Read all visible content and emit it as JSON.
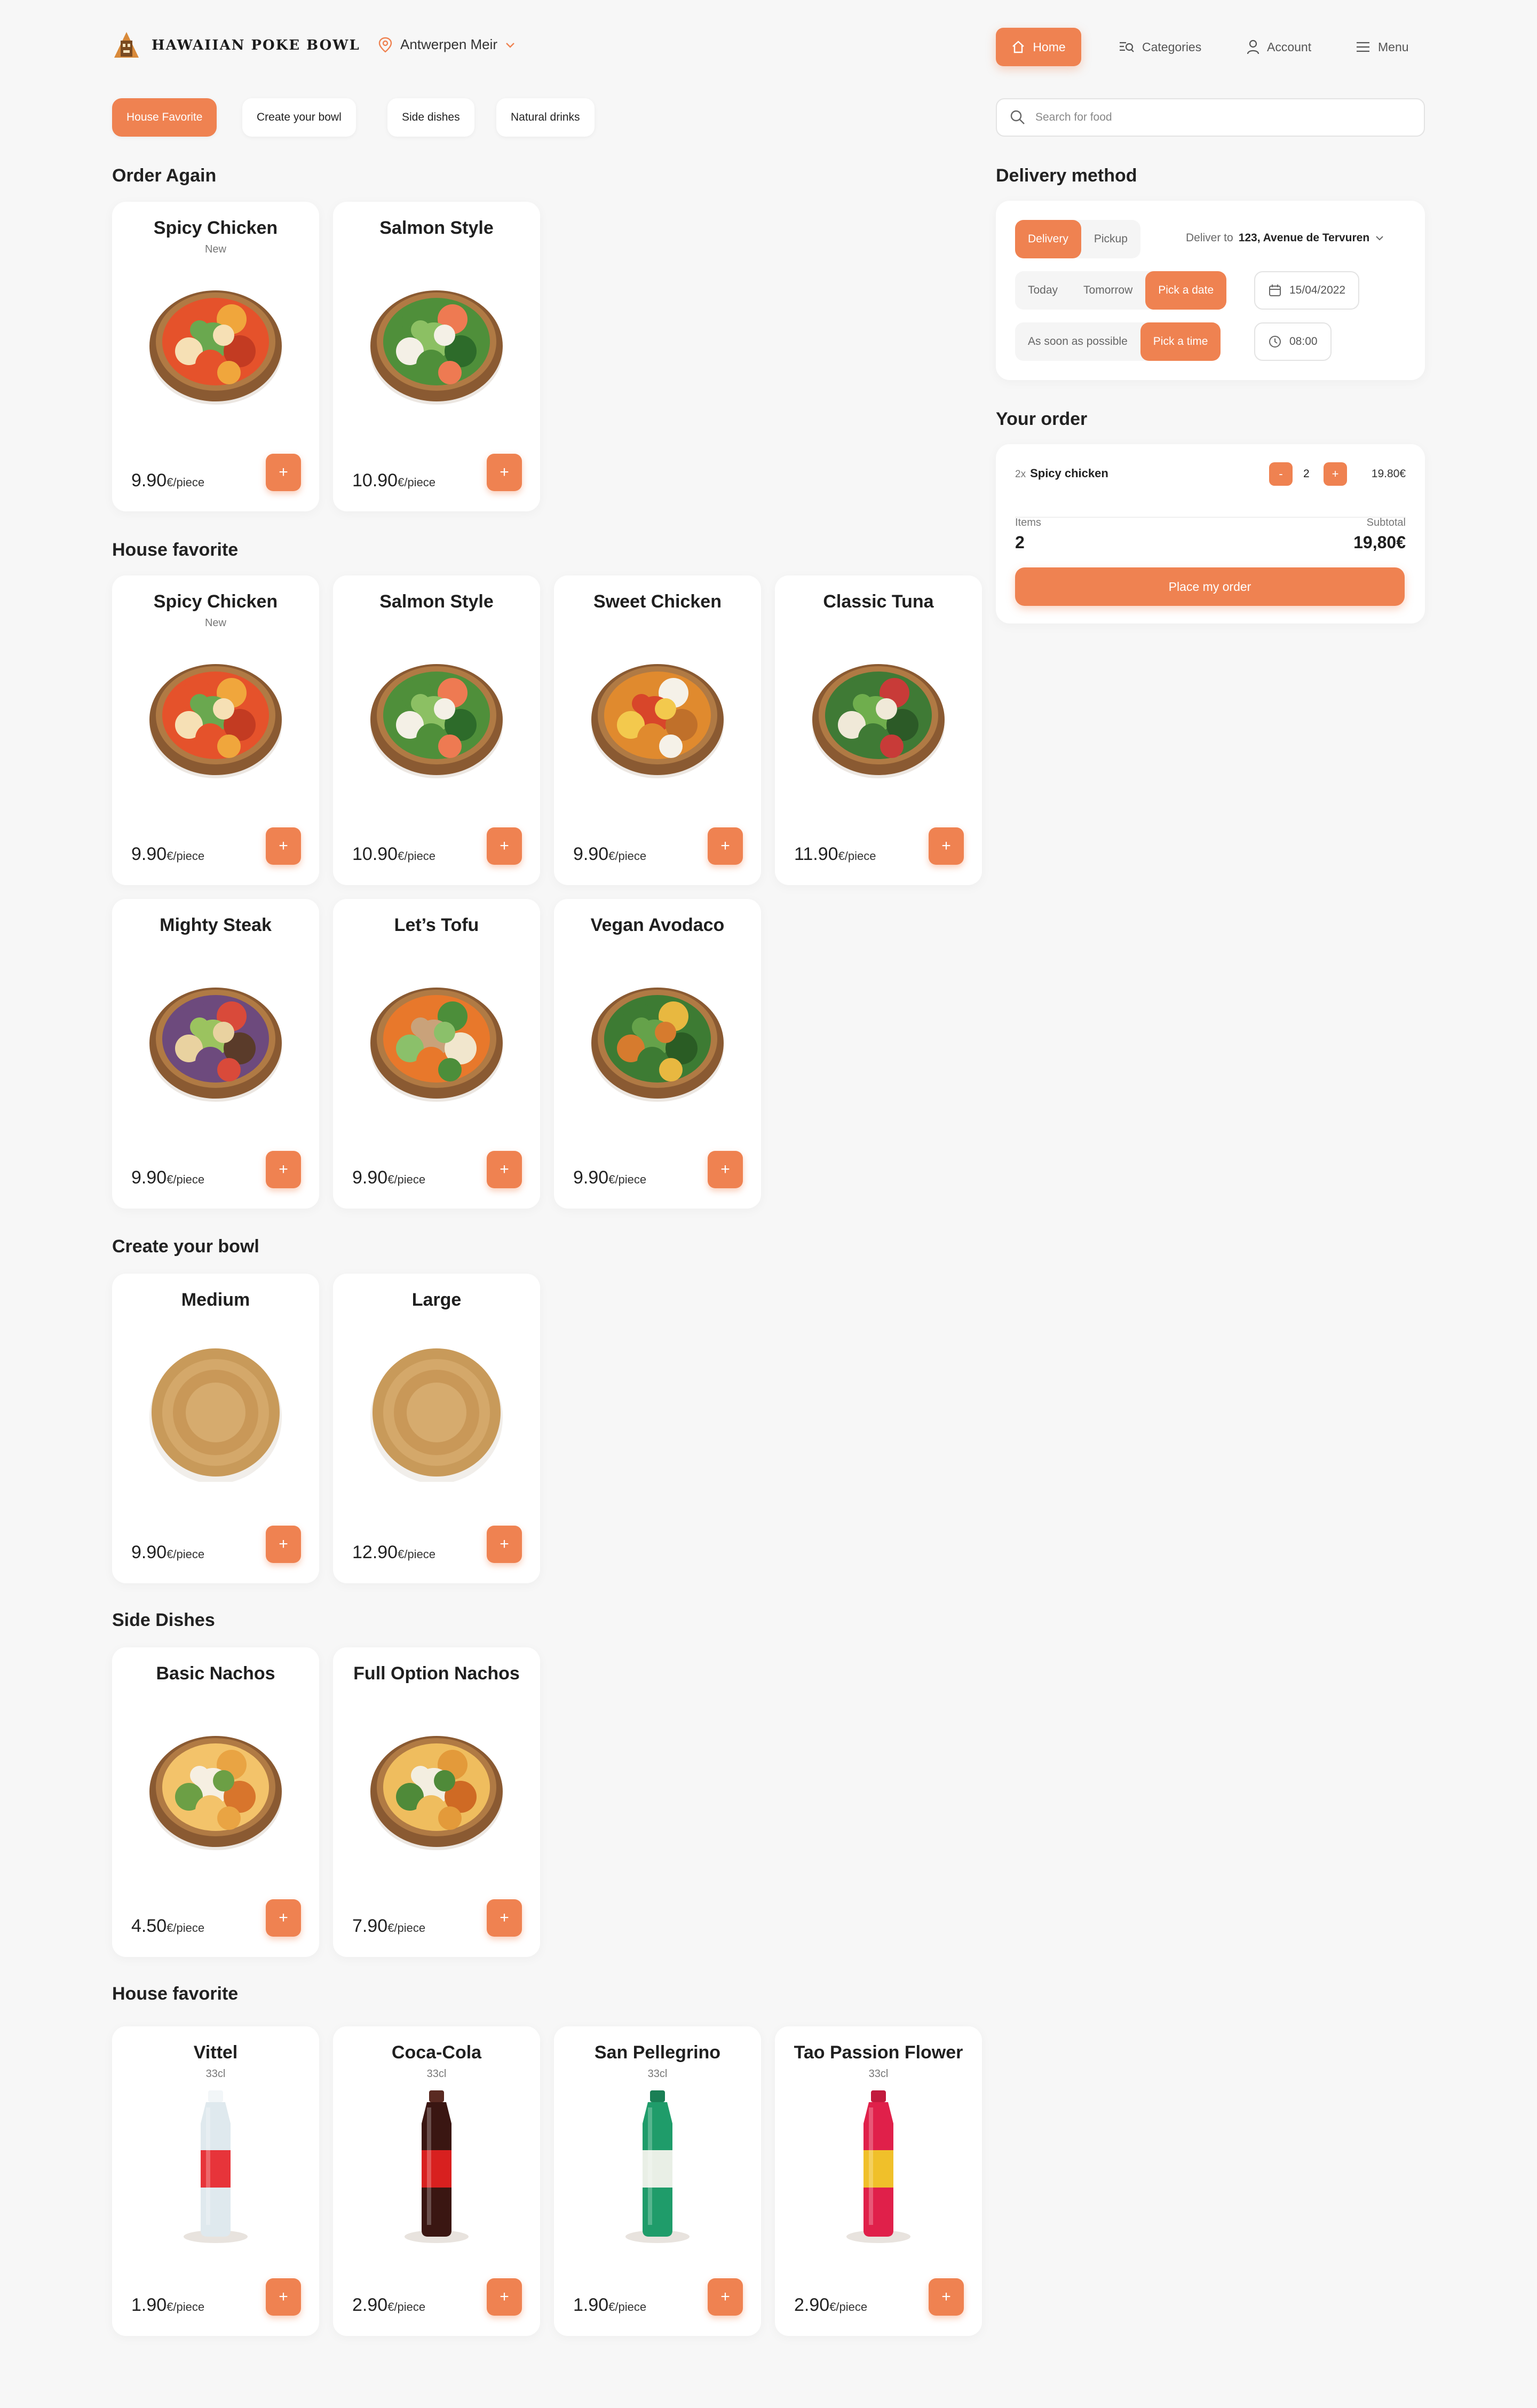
{
  "header": {
    "brand": "HAWAIIAN POKE BOWL",
    "location": "Antwerpen Meir",
    "nav": {
      "home": "Home",
      "categories": "Categories",
      "account": "Account",
      "menu": "Menu"
    }
  },
  "chips": [
    "House Favorite",
    "Create your bowl",
    "Side dishes",
    "Natural drinks"
  ],
  "search": {
    "placeholder": "Search for food"
  },
  "sections": {
    "order_again": {
      "title": "Order Again",
      "items": [
        {
          "name": "Spicy Chicken",
          "sub": "New",
          "price": "9.90",
          "unit": "€/piece",
          "image": "spicy-bowl"
        },
        {
          "name": "Salmon Style",
          "sub": "",
          "price": "10.90",
          "unit": "€/piece",
          "image": "salmon-bowl"
        }
      ]
    },
    "house_favorite": {
      "title": "House favorite",
      "items": [
        {
          "name": "Spicy Chicken",
          "sub": "New",
          "price": "9.90",
          "unit": "€/piece",
          "image": "spicy-bowl"
        },
        {
          "name": "Salmon Style",
          "sub": "",
          "price": "10.90",
          "unit": "€/piece",
          "image": "salmon-bowl"
        },
        {
          "name": "Sweet Chicken",
          "sub": "",
          "price": "9.90",
          "unit": "€/piece",
          "image": "sweet-bowl"
        },
        {
          "name": "Classic Tuna",
          "sub": "",
          "price": "11.90",
          "unit": "€/piece",
          "image": "tuna-bowl"
        },
        {
          "name": "Mighty Steak",
          "sub": "",
          "price": "9.90",
          "unit": "€/piece",
          "image": "steak-bowl"
        },
        {
          "name": "Let’s Tofu",
          "sub": "",
          "price": "9.90",
          "unit": "€/piece",
          "image": "tofu-bowl"
        },
        {
          "name": "Vegan Avodaco",
          "sub": "",
          "price": "9.90",
          "unit": "€/piece",
          "image": "vegan-bowl"
        }
      ]
    },
    "create_bowl": {
      "title": "Create your bowl",
      "items": [
        {
          "name": "Medium",
          "sub": "",
          "price": "9.90",
          "unit": "€/piece",
          "image": "empty-bowl"
        },
        {
          "name": "Large",
          "sub": "",
          "price": "12.90",
          "unit": "€/piece",
          "image": "empty-bowl"
        }
      ]
    },
    "side_dishes": {
      "title": "Side Dishes",
      "items": [
        {
          "name": "Basic Nachos",
          "sub": "",
          "price": "4.50",
          "unit": "€/piece",
          "image": "nachos"
        },
        {
          "name": "Full Option Nachos",
          "sub": "",
          "price": "7.90",
          "unit": "€/piece",
          "image": "nachos-full"
        }
      ]
    },
    "drinks": {
      "title": "House favorite",
      "items": [
        {
          "name": "Vittel",
          "sub": "33cl",
          "price": "1.90",
          "unit": "€/piece",
          "image": "water-bottle"
        },
        {
          "name": "Coca-Cola",
          "sub": "33cl",
          "price": "2.90",
          "unit": "€/piece",
          "image": "cola-bottle"
        },
        {
          "name": "San Pellegrino",
          "sub": "33cl",
          "price": "1.90",
          "unit": "€/piece",
          "image": "green-bottle"
        },
        {
          "name": "Tao Passion Flower",
          "sub": "33cl",
          "price": "2.90",
          "unit": "€/piece",
          "image": "red-bottle"
        }
      ]
    }
  },
  "add_label": "+",
  "delivery": {
    "title": "Delivery method",
    "delivery": "Delivery",
    "pickup": "Pickup",
    "deliver_to_label": "Deliver to",
    "address": "123, Avenue de Tervuren",
    "today": "Today",
    "tomorrow": "Tomorrow",
    "pick_date": "Pick a date",
    "date": "15/04/2022",
    "asap": "As soon as possible",
    "pick_time": "Pick a time",
    "time": "08:00"
  },
  "order": {
    "title": "Your order",
    "line_qty_prefix": "2x",
    "line_name": "Spicy chicken",
    "minus": "-",
    "qty": "2",
    "plus": "+",
    "line_price": "19.80€",
    "items_label": "Items",
    "items_value": "2",
    "subtotal_label": "Subtotal",
    "subtotal_value": "19,80€",
    "place_order": "Place my order"
  },
  "colors": {
    "accent": "#ef8251",
    "background": "#f7f7f7"
  }
}
